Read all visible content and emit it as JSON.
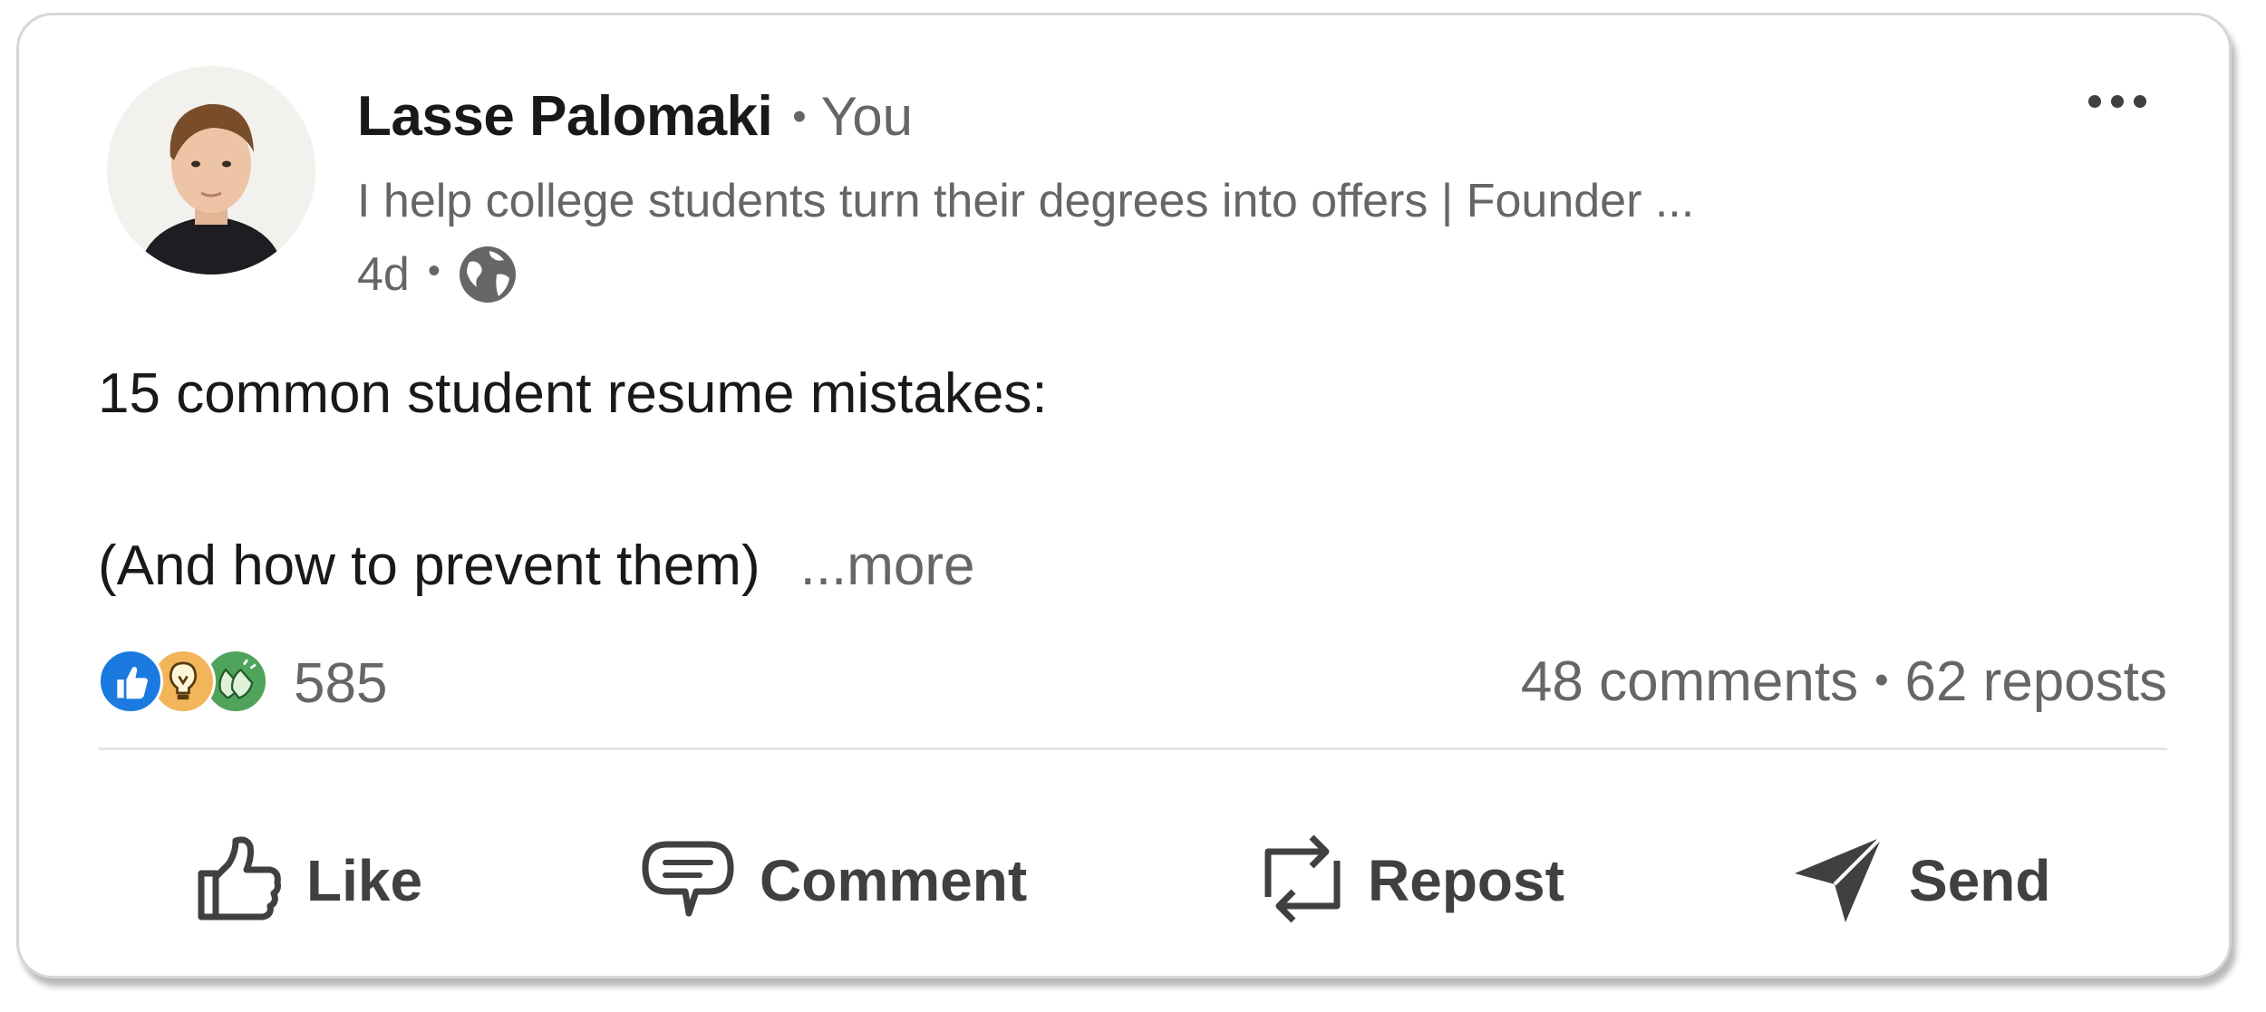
{
  "post": {
    "author": {
      "name": "Lasse Palomaki",
      "relation": "You",
      "headline": "I help college students turn their degrees into offers | Founder ...",
      "time": "4d",
      "visibility_icon": "globe-icon"
    },
    "menu_icon": "more-horizontal-icon",
    "body": {
      "line1": "15 common student resume mistakes:",
      "line2": "(And how to prevent them)",
      "see_more": "...more"
    },
    "social": {
      "reaction_icons": [
        "like-reaction-icon",
        "insightful-reaction-icon",
        "celebrate-reaction-icon"
      ],
      "reaction_count": "585",
      "comments": "48 comments",
      "reposts": "62 reposts"
    },
    "actions": {
      "like": "Like",
      "comment": "Comment",
      "repost": "Repost",
      "send": "Send"
    },
    "colors": {
      "text_primary": "#191919",
      "text_secondary": "#666666",
      "action_text": "#404040",
      "like_blue": "#1a7ae0",
      "insight_orange": "#f2b55a",
      "celebrate_green": "#4fa35a"
    }
  }
}
